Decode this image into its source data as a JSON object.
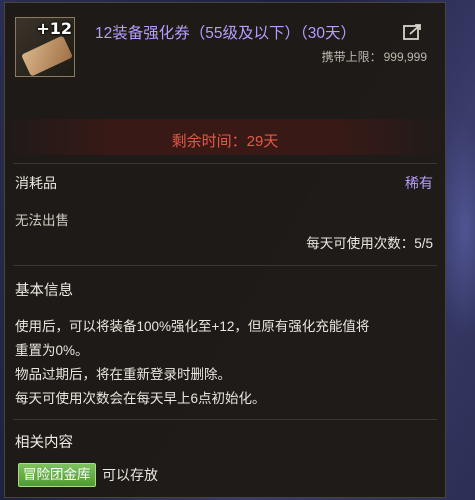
{
  "item": {
    "icon_badge": "+12",
    "title": "12装备强化券（55级及以下）（30天）",
    "carry_limit_label": "携带上限：",
    "carry_limit_value": "999,999"
  },
  "remaining_time": "剩余时间：29天",
  "category": {
    "type": "消耗品",
    "rarity": "稀有",
    "trade": "无法出售",
    "daily_uses": "每天可使用次数：5/5"
  },
  "basic_info": {
    "title": "基本信息",
    "lines": [
      "使用后，可以将装备100%强化至+12，但原有强化充能值将",
      "重置为0%。",
      "物品过期后，将在重新登录时删除。",
      "每天可使用次数会在每天早上6点初始化。"
    ]
  },
  "related": {
    "title": "相关内容",
    "badge": "冒险团金库",
    "text": "可以存放"
  },
  "colors": {
    "rarity": "#b79cff",
    "time": "#e05a48",
    "badge": "#5faa40"
  }
}
